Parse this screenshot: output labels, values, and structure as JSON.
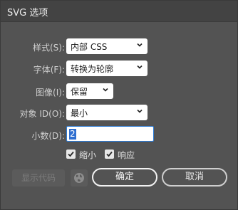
{
  "dialog": {
    "title": "SVG 选项"
  },
  "fields": {
    "style": {
      "label": "样式(S):",
      "value": "内部 CSS"
    },
    "font": {
      "label": "字体(F):",
      "value": "转换为轮廓"
    },
    "image": {
      "label": "图像(I):",
      "value": "保留"
    },
    "object_id": {
      "label": "对象 ID(O):",
      "value": "最小"
    },
    "decimals": {
      "label": "小数(D):",
      "value": "2"
    }
  },
  "options": {
    "minify": {
      "label": "缩小",
      "checked": true
    },
    "responsive": {
      "label": "响应",
      "checked": true
    }
  },
  "buttons": {
    "show_code": "显示代码",
    "ok": "确定",
    "cancel": "取消"
  },
  "icons": {
    "chevron": "chevron-down-icon",
    "globe": "globe-icon",
    "check": "check-icon"
  }
}
